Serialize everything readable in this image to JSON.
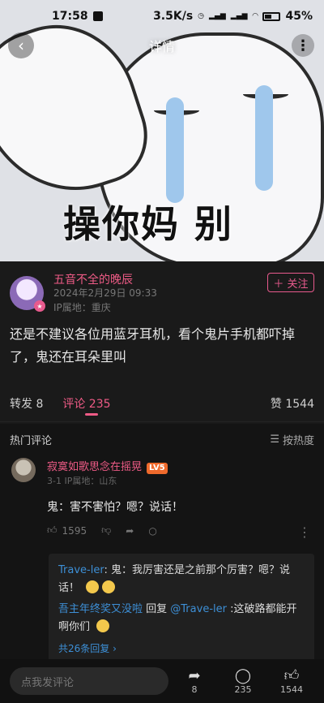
{
  "status": {
    "time": "17:58",
    "network_speed": "3.5K/s",
    "battery": "45%"
  },
  "nav": {
    "title": "详情",
    "back_icon": "chevron-left-icon",
    "more_icon": "more-vertical-icon"
  },
  "hero": {
    "meme_text": "操你妈 别"
  },
  "post": {
    "username": "五音不全的晚辰",
    "datetime": "2024年2月29日 09:33",
    "ip": "IP属地：重庆",
    "follow_label": "＋ 关注",
    "content": "还是不建议各位用蓝牙耳机，看个鬼片手机都吓掉了，鬼还在耳朵里叫"
  },
  "tabs": {
    "repost": "转发 8",
    "comments": "评论 235",
    "likes": "赞 1544"
  },
  "comments": {
    "header": "热门评论",
    "sort_label": "按热度",
    "items": [
      {
        "name": "寂寞如歌思念在摇晃",
        "level": "LV5",
        "meta": "3-1  IP属地：山东",
        "text": "鬼：害不害怕？嗯？说话！",
        "likes": "1595",
        "replies": {
          "r1_name": "Trave-ler",
          "r1_text": ": 鬼：我厉害还是之前那个厉害？嗯？说话！",
          "r2_name": "吾主年终奖又没啦",
          "r2_mid": " 回复 ",
          "r2_target": "@Trave-ler",
          "r2_text": " :这破路都能开啊你们",
          "more": "共26条回复 ›"
        }
      }
    ]
  },
  "bottom": {
    "input_placeholder": "点我发评论",
    "repost_count": "8",
    "comment_count": "235",
    "like_count": "1544"
  }
}
